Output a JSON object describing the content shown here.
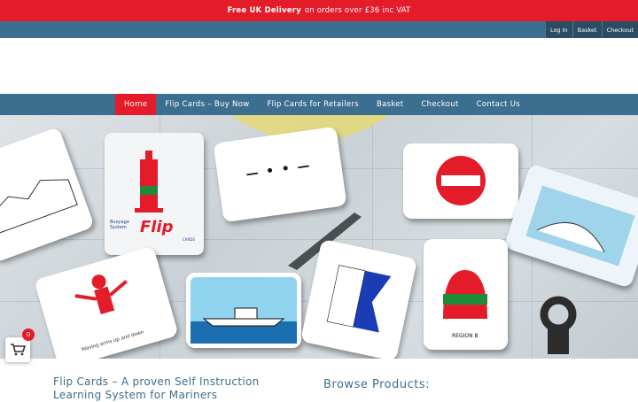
{
  "promo": {
    "strong": "Free UK Delivery",
    "rest": "on orders over £36 inc VAT"
  },
  "account": {
    "login": "Log In",
    "basket": "Basket",
    "checkout": "Checkout"
  },
  "nav": {
    "items": [
      "Home",
      "Flip Cards – Buy Now",
      "Flip Cards for Retailers",
      "Basket",
      "Checkout",
      "Contact Us"
    ],
    "active": "Home"
  },
  "hero": {
    "pack_brand": "Flip",
    "pack_label": "Buoyage System",
    "pack_small": "CARDS",
    "morse_text": "— • • —",
    "card_caption_person": "Waving arms up and down",
    "card_caption_region": "REGION B"
  },
  "content": {
    "intro_title": "Flip Cards – A proven Self Instruction Learning System for Mariners",
    "browse_title": "Browse Products:"
  },
  "cart": {
    "count": "0",
    "icon": "shopping-cart-icon"
  },
  "colors": {
    "brand_red": "#e41c2a",
    "brand_blue": "#3c6e8f"
  }
}
